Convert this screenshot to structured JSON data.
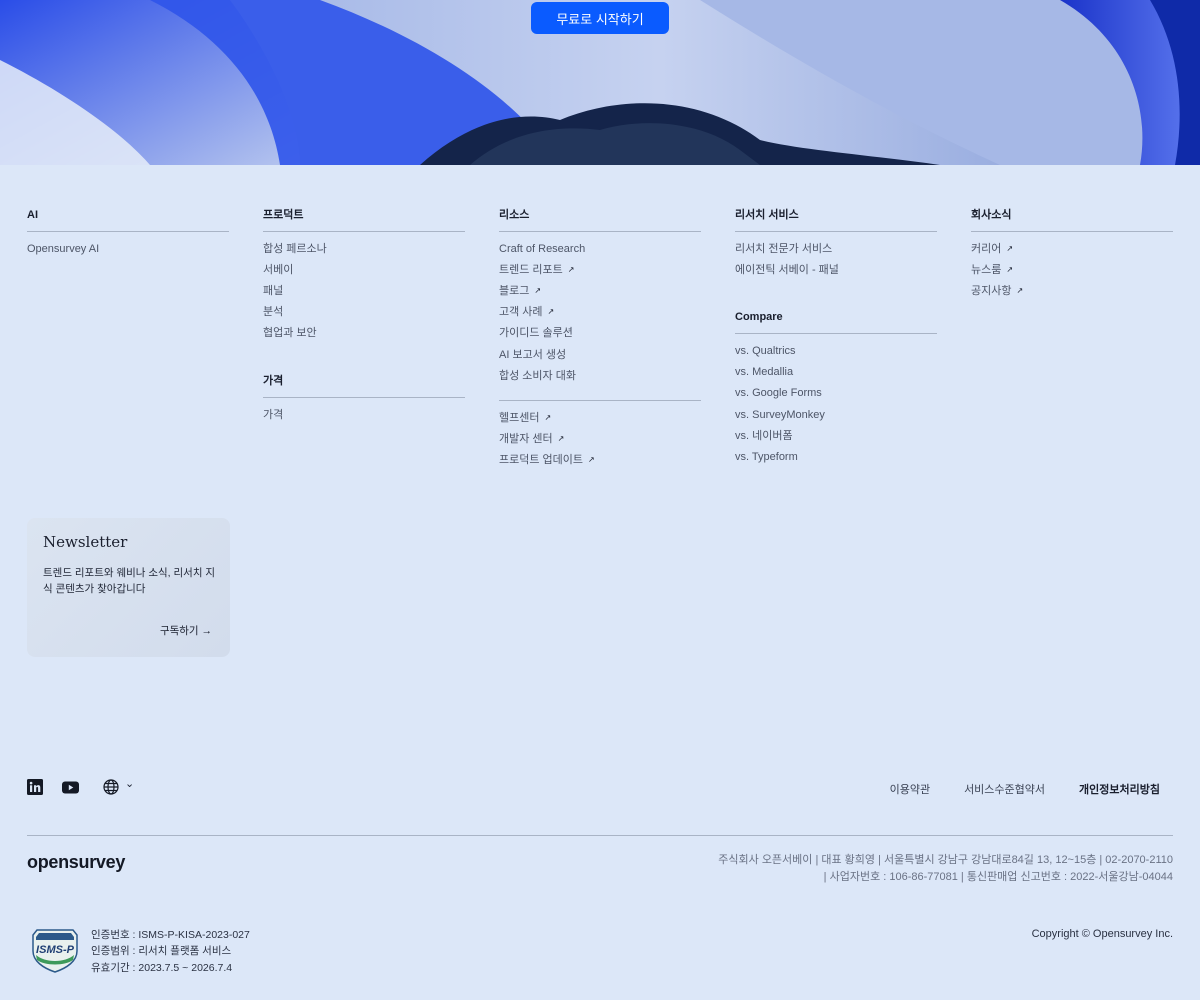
{
  "hero": {
    "cta_label": "무료로 시작하기"
  },
  "footer": {
    "columns": [
      {
        "title": "AI",
        "items": [
          {
            "label": "Opensurvey AI",
            "ext": false
          }
        ]
      },
      {
        "title": "프로덕트",
        "items": [
          {
            "label": "합성 페르소나",
            "ext": false
          },
          {
            "label": "서베이",
            "ext": false
          },
          {
            "label": "패널",
            "ext": false
          },
          {
            "label": "분석",
            "ext": false
          },
          {
            "label": "협업과 보안",
            "ext": false
          }
        ],
        "sub_title": "가격",
        "sub_items": [
          {
            "label": "가격",
            "ext": false
          }
        ]
      },
      {
        "title": "리소스",
        "items": [
          {
            "label": "Craft of Research",
            "ext": false
          },
          {
            "label": "트렌드 리포트",
            "ext": true
          },
          {
            "label": "블로그",
            "ext": true
          },
          {
            "label": "고객 사례",
            "ext": true
          },
          {
            "label": "가이디드 솔루션",
            "ext": false
          },
          {
            "label": "AI 보고서 생성",
            "ext": false
          },
          {
            "label": "합성 소비자 대화",
            "ext": false
          }
        ],
        "items2": [
          {
            "label": "헬프센터",
            "ext": true
          },
          {
            "label": "개발자 센터",
            "ext": true
          },
          {
            "label": "프로덕트 업데이트",
            "ext": true
          }
        ]
      },
      {
        "title": "리서치 서비스",
        "items": [
          {
            "label": "리서치 전문가 서비스",
            "ext": false
          },
          {
            "label": "에이전틱 서베이 - 패널",
            "ext": false
          }
        ],
        "sub_title": "Compare",
        "sub_items": [
          {
            "label": "vs. Qualtrics",
            "ext": false
          },
          {
            "label": "vs. Medallia",
            "ext": false
          },
          {
            "label": "vs. Google Forms",
            "ext": false
          },
          {
            "label": "vs. SurveyMonkey",
            "ext": false
          },
          {
            "label": "vs. 네이버폼",
            "ext": false
          },
          {
            "label": "vs. Typeform",
            "ext": false
          }
        ]
      },
      {
        "title": "회사소식",
        "items": [
          {
            "label": "커리어",
            "ext": true
          },
          {
            "label": "뉴스룸",
            "ext": true
          },
          {
            "label": "공지사항",
            "ext": true
          }
        ]
      }
    ],
    "ext_glyph": "↗",
    "newsletter": {
      "title": "Newsletter",
      "desc": "트렌드 리포트와 웨비나 소식, 리서치 지식 콘텐츠가 찾아갑니다",
      "button": "구독하기 →"
    },
    "social": {
      "icons": [
        "linkedin-icon",
        "youtube-icon",
        "globe-icon"
      ],
      "chevron": "⌄"
    },
    "legal": {
      "terms": "이용약관",
      "sla": "서비스수준협약서",
      "privacy": "개인정보처리방침"
    },
    "logo": "opensurvey",
    "company_line1": "주식회사 오픈서베이 | 대표 황희영 | 서울특별시 강남구 강남대로84길 13, 12~15층 | 02-2070-2110",
    "company_line2": "| 사업자번호 : 106-86-77081 | 통신판매업 신고번호 : 2022-서울강남-04044",
    "cert": {
      "badge_text": "ISMS-P",
      "line1": "인증번호 : ISMS-P-KISA-2023-027",
      "line2": "인증범위 : 리서치 플랫폼 서비스",
      "line3": "유효기간 : 2023.7.5 ~ 2026.7.4"
    },
    "copyright": "Copyright © Opensurvey Inc."
  },
  "colors": {
    "background": "#dce7f8",
    "accent": "#0a5bff",
    "hero_blue": "#2340d6"
  }
}
